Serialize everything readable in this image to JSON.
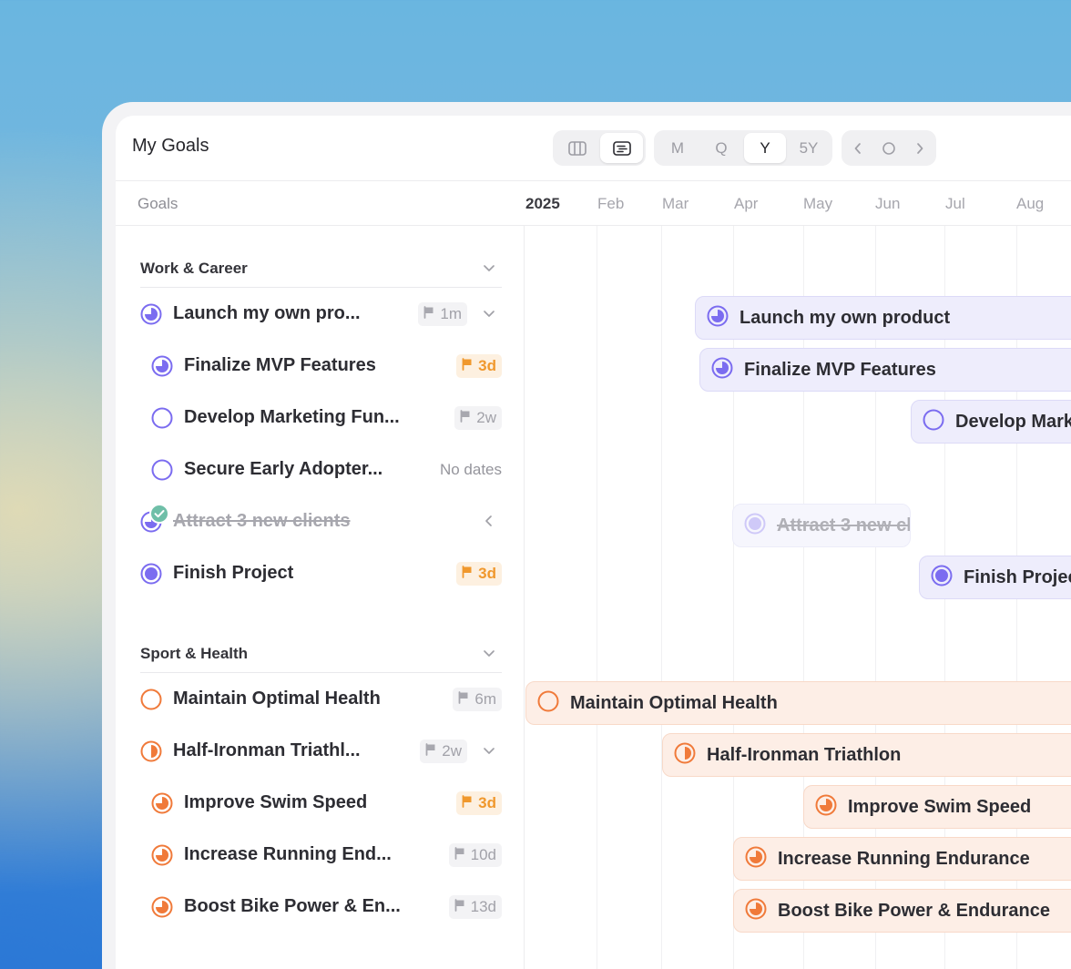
{
  "app": {
    "title": "My Goals"
  },
  "view_toggle": {
    "options": [
      "board-icon",
      "timeline-icon"
    ],
    "active": "timeline-icon"
  },
  "zoom": {
    "options": [
      "M",
      "Q",
      "Y",
      "5Y"
    ],
    "active": "Y"
  },
  "nav": {
    "prev": "chevron-left-icon",
    "today": "circle-icon",
    "next": "chevron-right-icon"
  },
  "columns": {
    "goals_label": "Goals"
  },
  "timeline": {
    "year": "2025",
    "months": [
      "Feb",
      "Mar",
      "Apr",
      "May",
      "Jun",
      "Jul",
      "Aug"
    ]
  },
  "groups": [
    {
      "title": "Work & Career",
      "accent": "#7b6cf0",
      "goals": [
        {
          "label": "Launch my own pro...",
          "full_label": "Launch my own product",
          "badge": "1m",
          "urgent": false,
          "has_children": true,
          "progress": 0.75
        },
        {
          "label": "Finalize MVP Features",
          "full_label": "Finalize MVP Features",
          "badge": "3d",
          "urgent": true,
          "progress": 0.75
        },
        {
          "label": "Develop Marketing Fun...",
          "full_label": "Develop Marketing Funnel",
          "badge": "2w",
          "urgent": false,
          "progress": 0
        },
        {
          "label": "Secure Early Adopter...",
          "badge_text": "No dates",
          "progress": 0
        },
        {
          "label": "Attract 3 new clients",
          "full_label": "Attract 3 new clients",
          "completed": true,
          "progress": 1
        },
        {
          "label": "Finish Project",
          "full_label": "Finish Project",
          "badge": "3d",
          "urgent": true,
          "progress": 1
        }
      ]
    },
    {
      "title": "Sport & Health",
      "accent": "#f07a3a",
      "goals": [
        {
          "label": "Maintain Optimal Health",
          "full_label": "Maintain Optimal Health",
          "badge": "6m",
          "urgent": false,
          "progress": 0
        },
        {
          "label": "Half-Ironman Triathl...",
          "full_label": "Half-Ironman Triathlon",
          "badge": "2w",
          "urgent": false,
          "has_children": true,
          "progress": 0.5
        },
        {
          "label": "Improve Swim Speed",
          "full_label": "Improve Swim Speed",
          "badge": "3d",
          "urgent": true,
          "progress": 0.75
        },
        {
          "label": "Increase Running End...",
          "full_label": "Increase Running Endurance",
          "badge": "10d",
          "urgent": false,
          "progress": 0.75
        },
        {
          "label": "Boost Bike Power & En...",
          "full_label": "Boost Bike Power & Endurance",
          "badge": "13d",
          "urgent": false,
          "progress": 0.75
        }
      ]
    }
  ]
}
